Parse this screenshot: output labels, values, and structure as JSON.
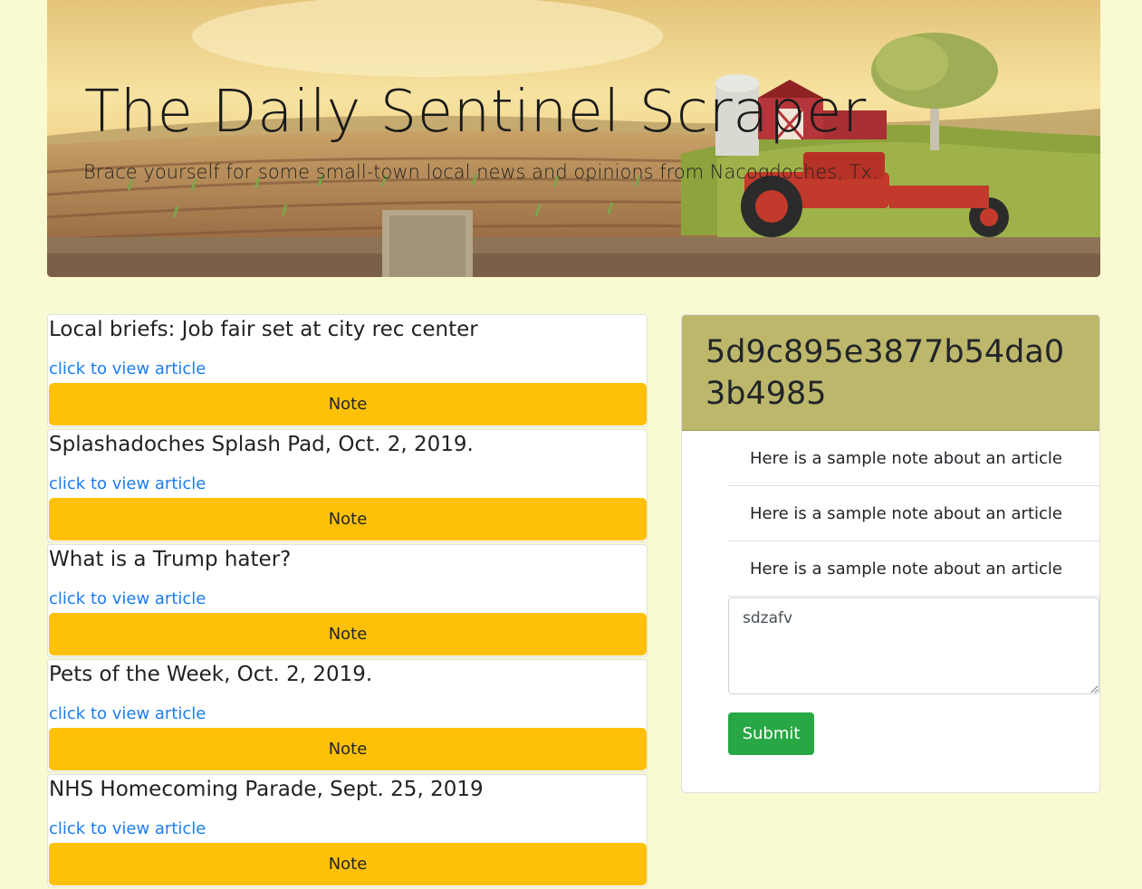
{
  "jumbotron": {
    "title": "The Daily Sentinel Scraper",
    "lead": "Brace yourself for some small-town local news and opinions from Nacogdoches, Tx.",
    "image": "farm-landscape-with-barn-silo-tractor-fence"
  },
  "articles": [
    {
      "title": "Local briefs: Job fair set at city rec center",
      "link_text": "click to view article",
      "button_label": "Note"
    },
    {
      "title": "Splashadoches Splash Pad, Oct. 2, 2019.",
      "link_text": "click to view article",
      "button_label": "Note"
    },
    {
      "title": "What is a Trump hater?",
      "link_text": "click to view article",
      "button_label": "Note"
    },
    {
      "title": "Pets of the Week, Oct. 2, 2019.",
      "link_text": "click to view article",
      "button_label": "Note"
    },
    {
      "title": "NHS Homecoming Parade, Sept. 25, 2019",
      "link_text": "click to view article",
      "button_label": "Note"
    }
  ],
  "notes_panel": {
    "article_id": "5d9c895e3877b54da03b4985",
    "notes": [
      "Here is a sample note about an article",
      "Here is a sample note about an article",
      "Here is a sample note about an article"
    ],
    "input_value": "sdzafv",
    "submit_label": "Submit"
  },
  "colors": {
    "page_background": "#f9f9d2",
    "note_button": "#ffc107",
    "notes_header": "#bdb76b",
    "submit_button": "#28a745",
    "link": "#1a7cf0"
  }
}
